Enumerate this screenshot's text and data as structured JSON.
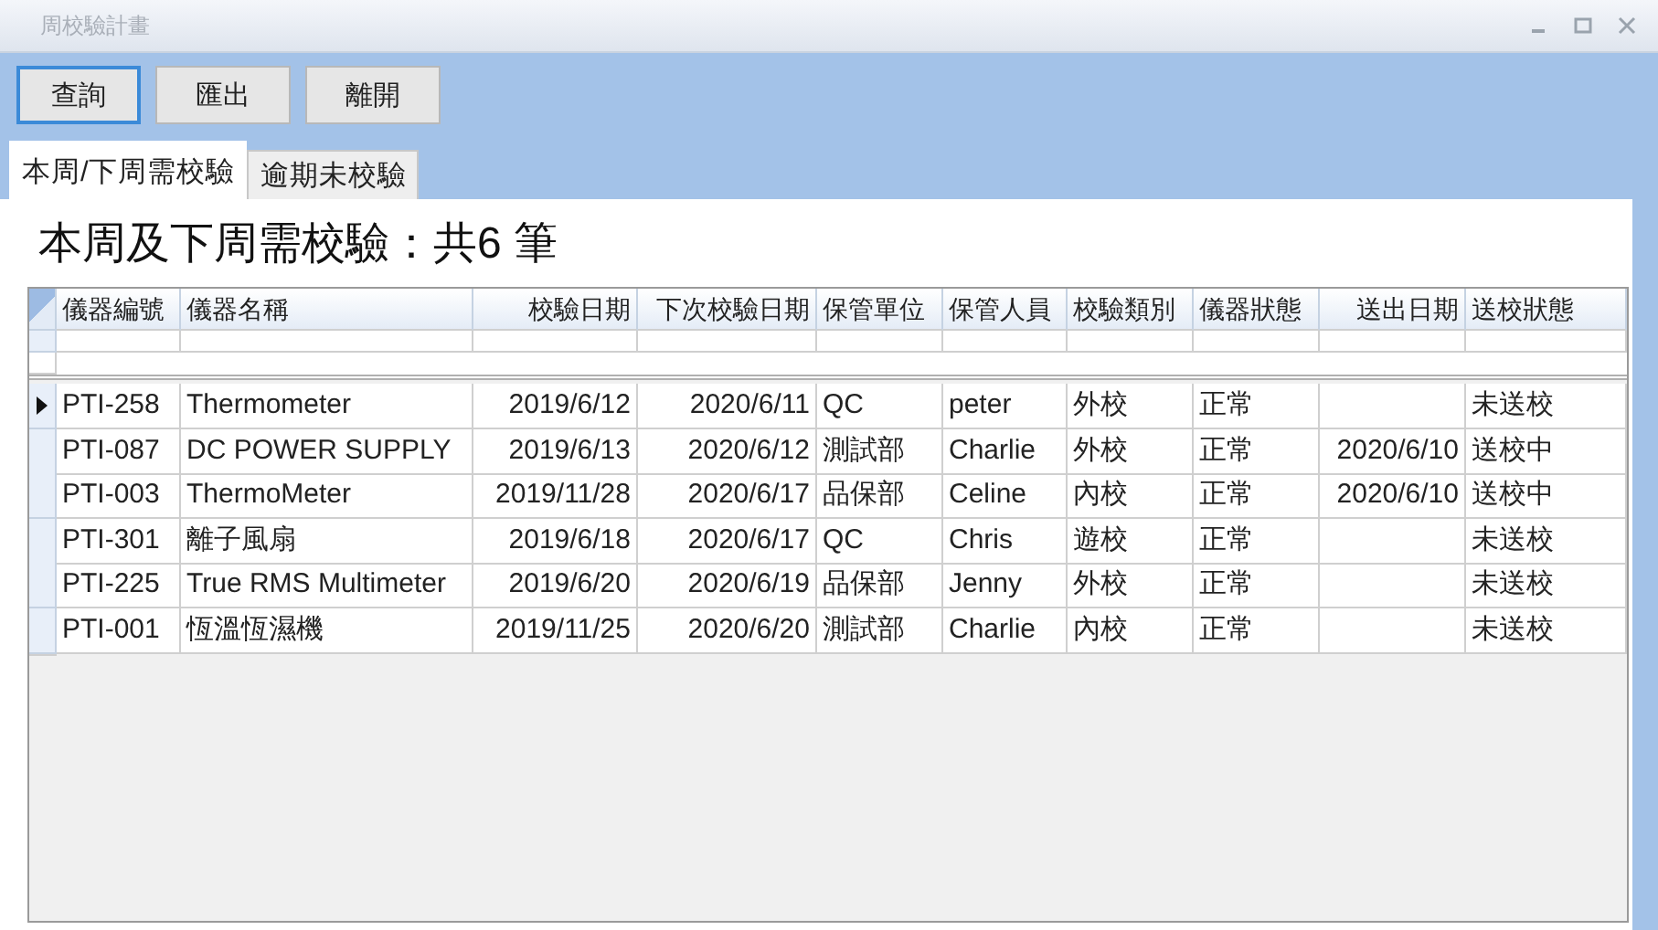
{
  "window": {
    "title": "周校驗計畫"
  },
  "buttons": [
    {
      "label": "查詢",
      "focused": true
    },
    {
      "label": "匯出",
      "focused": false
    },
    {
      "label": "離開",
      "focused": false
    }
  ],
  "tabs": [
    {
      "label": "本周/下周需校驗",
      "selected": true
    },
    {
      "label": "逾期未校驗",
      "selected": false
    }
  ],
  "heading": "本周及下周需校驗：共6 筆",
  "table": {
    "columns": [
      {
        "label": "儀器編號",
        "kind": "text"
      },
      {
        "label": "儀器名稱",
        "kind": "text"
      },
      {
        "label": "校驗日期",
        "kind": "date"
      },
      {
        "label": "下次校驗日期",
        "kind": "date"
      },
      {
        "label": "保管單位",
        "kind": "text"
      },
      {
        "label": "保管人員",
        "kind": "text"
      },
      {
        "label": "校驗類別",
        "kind": "text"
      },
      {
        "label": "儀器狀態",
        "kind": "text"
      },
      {
        "label": "送出日期",
        "kind": "date"
      },
      {
        "label": "送校狀態",
        "kind": "text"
      }
    ],
    "rows": [
      {
        "selected": true,
        "cells": [
          "PTI-258",
          "Thermometer",
          "2019/6/12",
          "2020/6/11",
          "QC",
          "peter",
          "外校",
          "正常",
          "",
          "未送校"
        ]
      },
      {
        "selected": false,
        "cells": [
          "PTI-087",
          "DC POWER SUPPLY",
          "2019/6/13",
          "2020/6/12",
          "測試部",
          "Charlie",
          "外校",
          "正常",
          "2020/6/10",
          "送校中"
        ]
      },
      {
        "selected": false,
        "cells": [
          "PTI-003",
          "ThermoMeter",
          "2019/11/28",
          "2020/6/17",
          "品保部",
          "Celine",
          "內校",
          "正常",
          "2020/6/10",
          "送校中"
        ]
      },
      {
        "selected": false,
        "cells": [
          "PTI-301",
          "離子風扇",
          "2019/6/18",
          "2020/6/17",
          "QC",
          "Chris",
          "遊校",
          "正常",
          "",
          "未送校"
        ]
      },
      {
        "selected": false,
        "cells": [
          "PTI-225",
          "True RMS Multimeter",
          "2019/6/20",
          "2020/6/19",
          "品保部",
          "Jenny",
          "外校",
          "正常",
          "",
          "未送校"
        ]
      },
      {
        "selected": false,
        "cells": [
          "PTI-001",
          "恆溫恆濕機",
          "2019/11/25",
          "2020/6/20",
          "測試部",
          "Charlie",
          "內校",
          "正常",
          "",
          "未送校"
        ]
      }
    ]
  }
}
